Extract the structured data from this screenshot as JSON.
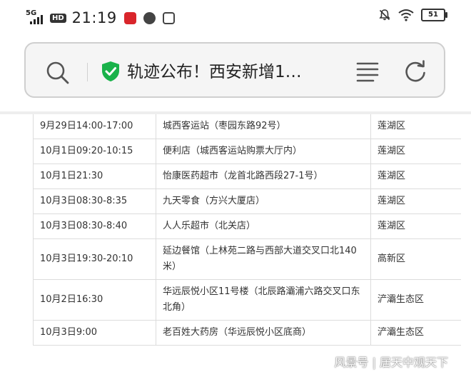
{
  "status_bar": {
    "network": "5G",
    "hd": "HD",
    "time": "21:19",
    "battery": "51"
  },
  "address_bar": {
    "title": "轨迹公布！西安新增1…"
  },
  "table": {
    "rows": [
      {
        "time": "9月29日14:00-17:00",
        "place": "城西客运站（枣园东路92号）",
        "district": "莲湖区"
      },
      {
        "time": "10月1日09:20-10:15",
        "place": "便利店（城西客运站购票大厅内）",
        "district": "莲湖区"
      },
      {
        "time": "10月1日21:30",
        "place": "怡康医药超市（龙首北路西段27-1号）",
        "district": "莲湖区"
      },
      {
        "time": "10月3日08:30-8:35",
        "place": "九天零食（方兴大厦店）",
        "district": "莲湖区"
      },
      {
        "time": "10月3日08:30-8:40",
        "place": "人人乐超市（北关店）",
        "district": "莲湖区"
      },
      {
        "time": "10月3日19:30-20:10",
        "place": "延边餐馆（上林苑二路与西部大道交叉口北140米）",
        "district": "高新区"
      },
      {
        "time": "10月2日16:30",
        "place": "华远辰悦小区11号楼（北辰路灞浦六路交叉口东北角）",
        "district": "浐灞生态区"
      },
      {
        "time": "10月3日9:00",
        "place": "老百姓大药房（华远辰悦小区底商）",
        "district": "浐灞生态区"
      }
    ]
  },
  "watermark": "风景号 | 居天中观天下"
}
